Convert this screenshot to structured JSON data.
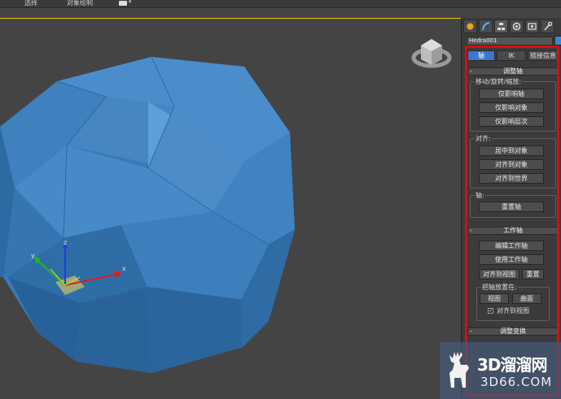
{
  "topbar": {
    "tab1": "选择",
    "tab2": "对象绘制"
  },
  "colors": {
    "accent_blue": "#3b78c9",
    "highlight_red": "#d41010",
    "object_color": "#3d86d6",
    "viewport_border": "#f2c600"
  },
  "gizmo": {
    "x_label": "x",
    "y_label": "y",
    "z_label": "z"
  },
  "panel": {
    "object_name": "Hedra001",
    "tab_icons": [
      "create-icon",
      "modify-icon",
      "hierarchy-icon",
      "motion-icon",
      "display-icon",
      "utilities-icon"
    ],
    "sub_tabs": [
      "轴",
      "IK",
      "链接信息"
    ],
    "adjust_pivot": {
      "title": "调整轴",
      "move_group": {
        "label": "移动/旋转/缩放:",
        "buttons": [
          "仅影响轴",
          "仅影响对象",
          "仅影响层次"
        ]
      },
      "align_group": {
        "label": "对齐:",
        "buttons": [
          "居中到对象",
          "对齐到对象",
          "对齐到世界"
        ]
      },
      "pivot_group": {
        "label": "轴:",
        "button": "重置轴"
      }
    },
    "working_pivot": {
      "title": "工作轴",
      "buttons": [
        "编辑工作轴",
        "使用工作轴"
      ],
      "align_to_view": "对齐到视图",
      "reset": "重置",
      "place_group": {
        "label": "把轴放置在:",
        "view": "视图",
        "surface": "曲面",
        "checkbox_label": "对齐到视图",
        "checked": true
      }
    },
    "adjust_transform": {
      "title": "调整变换"
    }
  },
  "watermark": {
    "title": "3D溜溜网",
    "subtitle": "3D66.COM"
  }
}
